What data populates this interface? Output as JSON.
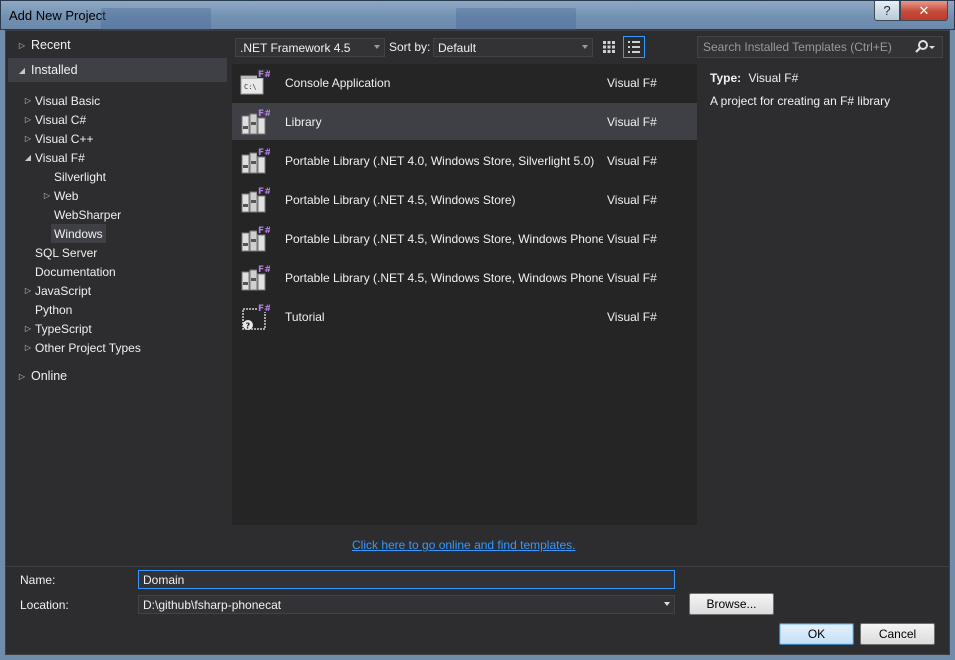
{
  "window": {
    "title": "Add New Project",
    "help_label": "?",
    "close_label": "✕"
  },
  "tree": {
    "recent": "Recent",
    "installed": "Installed",
    "items": [
      {
        "label": "Visual Basic",
        "expandable": true
      },
      {
        "label": "Visual C#",
        "expandable": true
      },
      {
        "label": "Visual C++",
        "expandable": true
      },
      {
        "label": "Visual F#",
        "expandable": true,
        "expanded": true
      },
      {
        "label": "Silverlight",
        "expandable": false
      },
      {
        "label": "Web",
        "expandable": true
      },
      {
        "label": "WebSharper",
        "expandable": false
      },
      {
        "label": "Windows",
        "expandable": false,
        "selected": true
      },
      {
        "label": "SQL Server",
        "expandable": false
      },
      {
        "label": "Documentation",
        "expandable": false
      },
      {
        "label": "JavaScript",
        "expandable": true
      },
      {
        "label": "Python",
        "expandable": false
      },
      {
        "label": "TypeScript",
        "expandable": true
      },
      {
        "label": "Other Project Types",
        "expandable": true
      }
    ],
    "online": "Online"
  },
  "toolbar": {
    "framework": ".NET Framework 4.5",
    "sort_label": "Sort by:",
    "sort_value": "Default",
    "search_placeholder": "Search Installed Templates (Ctrl+E)"
  },
  "templates": [
    {
      "name": "Console Application",
      "lang": "Visual F#",
      "icon": "console-app-icon"
    },
    {
      "name": "Library",
      "lang": "Visual F#",
      "icon": "library-icon",
      "selected": true
    },
    {
      "name": "Portable Library (.NET 4.0, Windows Store, Silverlight 5.0)",
      "lang": "Visual F#",
      "icon": "portable-library-icon"
    },
    {
      "name": "Portable Library (.NET 4.5, Windows Store)",
      "lang": "Visual F#",
      "icon": "portable-library-icon"
    },
    {
      "name": "Portable Library (.NET 4.5, Windows Store, Windows Phone...",
      "lang": "Visual F#",
      "icon": "portable-library-icon"
    },
    {
      "name": "Portable Library (.NET 4.5, Windows Store, Windows Phone...",
      "lang": "Visual F#",
      "icon": "portable-library-icon"
    },
    {
      "name": "Tutorial",
      "lang": "Visual F#",
      "icon": "tutorial-icon"
    }
  ],
  "details": {
    "type_label": "Type:",
    "type_value": "Visual F#",
    "description": "A project for creating an F# library"
  },
  "online_link": "Click here to go online and find templates.",
  "form": {
    "name_label": "Name:",
    "name_value": "Domain",
    "location_label": "Location:",
    "location_value": "D:\\github\\fsharp-phonecat",
    "browse_label": "Browse...",
    "ok_label": "OK",
    "cancel_label": "Cancel"
  },
  "colors": {
    "background": "#2d2d30",
    "list_background": "#252526",
    "selection": "#3f3f46",
    "accent": "#3399ff",
    "fsharp_purple": "#9b6bd6"
  }
}
